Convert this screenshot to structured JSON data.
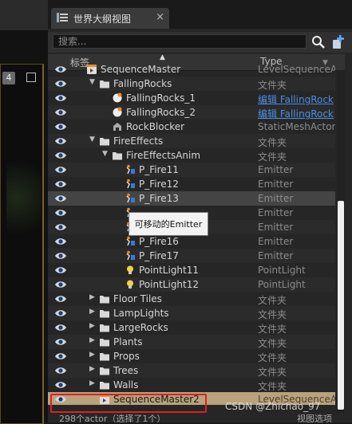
{
  "panel": {
    "tab_title": "世界大纲视图",
    "tab_close": "×",
    "search_placeholder": "搜索...",
    "header_label": "标签",
    "header_type": "Type"
  },
  "viewport": {
    "number_badge": "4"
  },
  "rows": [
    {
      "label": "SequenceMaster",
      "type": "LevelSequenceAct",
      "icon": "sequence-icon",
      "depth": 0,
      "alt": false
    },
    {
      "label": "FallingRocks",
      "type": "文件夹",
      "icon": "folder-icon",
      "depth": 1,
      "arrow": "▼",
      "alt": true
    },
    {
      "label": "FallingRocks_1",
      "type": "编辑 FallingRock",
      "icon": "sphere-icon",
      "depth": 2,
      "link": true,
      "alt": false
    },
    {
      "label": "FallingRocks_2",
      "type": "编辑 FallingRock",
      "icon": "sphere-icon",
      "depth": 2,
      "link": true,
      "alt": true
    },
    {
      "label": "RockBlocker",
      "type": "StaticMeshActor",
      "icon": "mesh-icon",
      "depth": 2,
      "alt": false
    },
    {
      "label": "FireEffects",
      "type": "文件夹",
      "icon": "folder-icon",
      "depth": 1,
      "arrow": "▼",
      "alt": true
    },
    {
      "label": "FireEffectsAnim",
      "type": "文件夹",
      "icon": "folder-icon",
      "depth": 2,
      "arrow": "▼",
      "alt": false
    },
    {
      "label": "P_Fire11",
      "type": "Emitter",
      "icon": "emitter-icon",
      "depth": 3,
      "alt": true
    },
    {
      "label": "P_Fire12",
      "type": "Emitter",
      "icon": "emitter-icon",
      "depth": 3,
      "alt": false
    },
    {
      "label": "P_Fire13",
      "type": "Emitter",
      "icon": "emitter-icon",
      "depth": 3,
      "hover": true
    },
    {
      "label": "",
      "type": "Emitter",
      "icon": "emitter-icon",
      "depth": 3,
      "alt": false
    },
    {
      "label": "",
      "type": "Emitter",
      "icon": "emitter-icon",
      "depth": 3,
      "alt": true
    },
    {
      "label": "P_Fire16",
      "type": "Emitter",
      "icon": "emitter-icon",
      "depth": 3,
      "alt": false
    },
    {
      "label": "P_Fire17",
      "type": "Emitter",
      "icon": "emitter-icon",
      "depth": 3,
      "alt": true
    },
    {
      "label": "PointLight11",
      "type": "PointLight",
      "icon": "bulb-icon",
      "depth": 3,
      "alt": false
    },
    {
      "label": "PointLight12",
      "type": "PointLight",
      "icon": "bulb-icon",
      "depth": 3,
      "alt": true
    },
    {
      "label": "Floor Tiles",
      "type": "文件夹",
      "icon": "folder-icon",
      "depth": 1,
      "arrow": "▶",
      "alt": false
    },
    {
      "label": "LampLights",
      "type": "文件夹",
      "icon": "folder-icon",
      "depth": 1,
      "arrow": "▶",
      "alt": true
    },
    {
      "label": "LargeRocks",
      "type": "文件夹",
      "icon": "folder-icon",
      "depth": 1,
      "arrow": "▶",
      "alt": false
    },
    {
      "label": "Plants",
      "type": "文件夹",
      "icon": "folder-icon",
      "depth": 1,
      "arrow": "▶",
      "alt": true
    },
    {
      "label": "Props",
      "type": "文件夹",
      "icon": "folder-icon",
      "depth": 1,
      "arrow": "▶",
      "alt": false
    },
    {
      "label": "Trees",
      "type": "文件夹",
      "icon": "folder-icon",
      "depth": 1,
      "arrow": "▶",
      "alt": true
    },
    {
      "label": "Walls",
      "type": "文件夹",
      "icon": "folder-icon",
      "depth": 1,
      "arrow": "▶",
      "alt": false
    },
    {
      "label": "SequenceMaster2",
      "type": "LevelSequenceAct",
      "icon": "sequence-icon",
      "depth": 1,
      "selected": true
    }
  ],
  "tooltip": "可移动的Emitter",
  "footer": {
    "count": "298个actor（选择了1个）",
    "view_options": "视图选项"
  },
  "watermark": "CSDN @Zhichao_97",
  "colors": {
    "panel_bg": "#262626",
    "selected_row": "#b9a27c",
    "link": "#4a8fe0",
    "highlight_box": "#e02020",
    "folder": "#d9d9d9"
  }
}
